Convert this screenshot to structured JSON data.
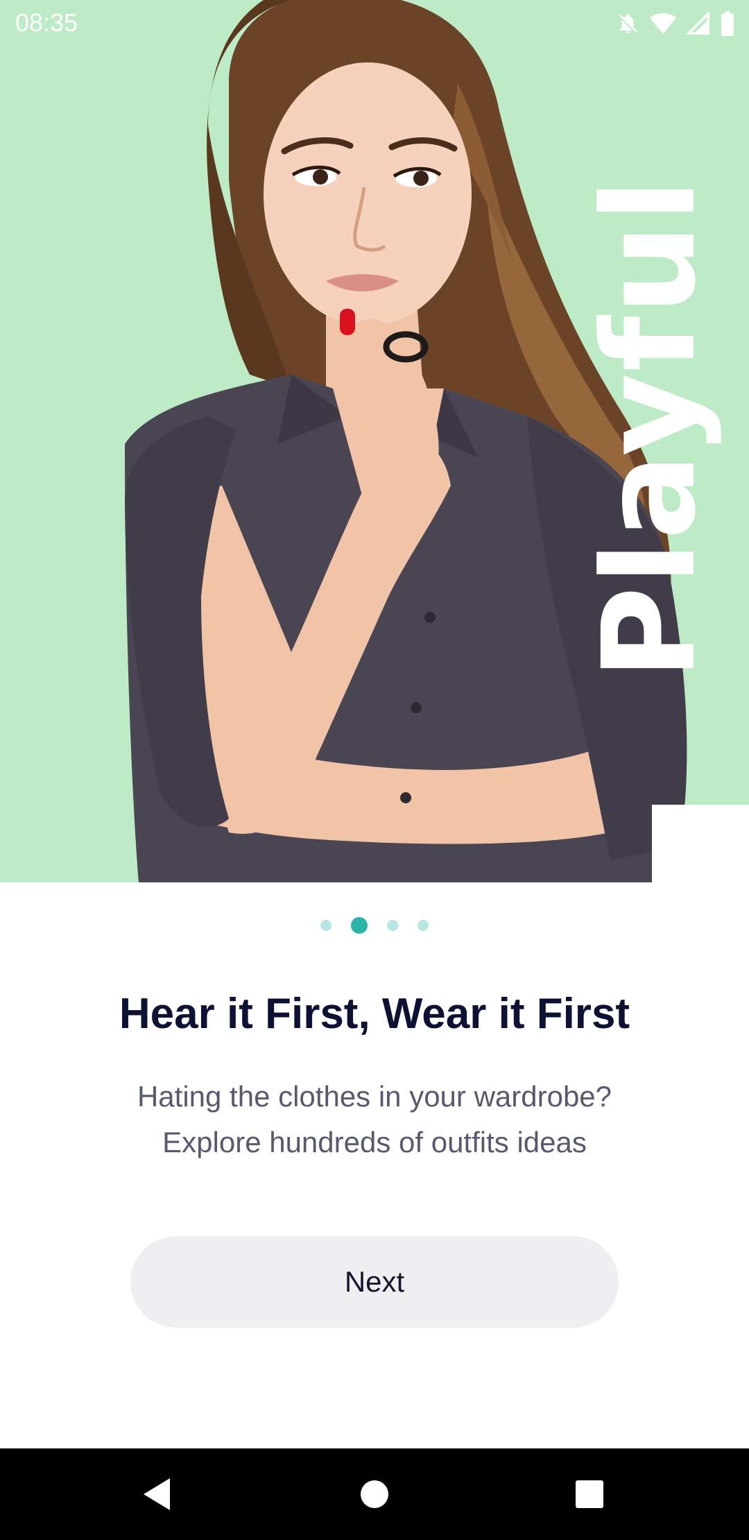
{
  "status_bar": {
    "time": "08:35",
    "icons": [
      "notifications-off-icon",
      "wifi-icon",
      "signal-icon",
      "battery-icon"
    ]
  },
  "hero": {
    "vertical_word": "Playful",
    "background_color": "#bdebc5",
    "image": "woman-thinking-photo"
  },
  "pagination": {
    "total": 4,
    "active_index": 1,
    "active_color": "#2bb5a8",
    "inactive_color": "#b5e6e2"
  },
  "content": {
    "headline": "Hear it First, Wear it First",
    "subtext_line1": "Hating the clothes in your wardrobe?",
    "subtext_line2": "Explore hundreds of outfits ideas"
  },
  "actions": {
    "next_label": "Next"
  },
  "nav_bar": {
    "buttons": [
      "back-icon",
      "home-icon",
      "recents-icon"
    ]
  }
}
